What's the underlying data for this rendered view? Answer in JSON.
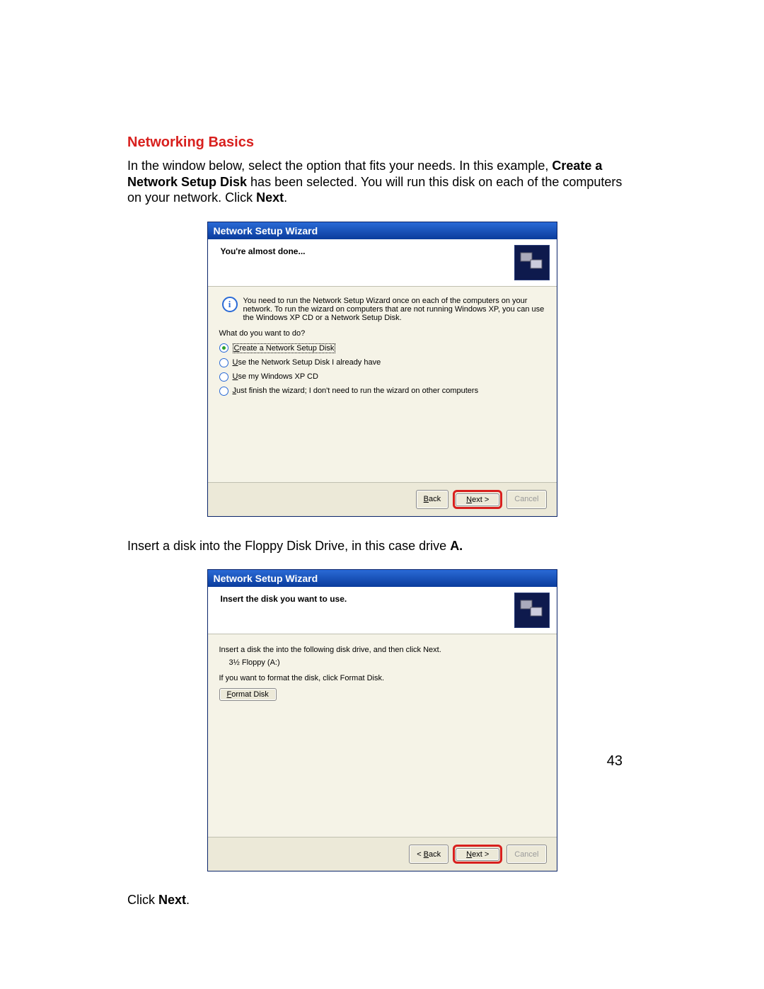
{
  "heading": "Networking Basics",
  "intro": {
    "p1a": "In the window below, select the option that fits your needs. In this example, ",
    "p1b_bold": "Create a Network Setup Disk",
    "p1c": " has been selected.  You will run this disk on each of the computers on your network. Click ",
    "p1d_bold": "Next",
    "p1e": "."
  },
  "wizard1": {
    "titlebar": "Network Setup Wizard",
    "header_title": "You're almost done...",
    "icon_alt": "computers",
    "info_text": "You need to run the Network Setup Wizard once on each of the computers on your network. To run the wizard on computers that are not running Windows XP, you can use the Windows XP CD or a Network Setup Disk.",
    "question": "What do you want to do?",
    "options": [
      {
        "prefix": "C",
        "label_rest": "reate a Network Setup Disk",
        "selected": true,
        "boxed": true
      },
      {
        "prefix": "U",
        "label_rest": "se the Network Setup Disk I already have",
        "selected": false,
        "boxed": false
      },
      {
        "prefix": "U",
        "label_rest": "se my Windows XP CD",
        "selected": false,
        "boxed": false
      },
      {
        "prefix": "J",
        "label_rest": "ust finish the wizard; I don't need to run the wizard on other computers",
        "selected": false,
        "boxed": false
      }
    ],
    "buttons": {
      "back": "< Back",
      "next": "Next >",
      "cancel": "Cancel"
    }
  },
  "mid_text": {
    "a": "Insert a disk into the Floppy Disk Drive, in this case drive ",
    "b_bold": "A."
  },
  "wizard2": {
    "titlebar": "Network Setup Wizard",
    "header_title": "Insert the disk you want to use.",
    "icon_alt": "computers",
    "line1": "Insert a disk the into the following disk drive, and then click Next.",
    "drive": "3½ Floppy (A:)",
    "line2": "If you want to format the disk, click Format Disk.",
    "format_btn": "Format Disk",
    "buttons": {
      "back": "< Back",
      "next": "Next >",
      "cancel": "Cancel"
    }
  },
  "click_next": {
    "a": "Click ",
    "b_bold": "Next",
    "c": "."
  },
  "page_number": "43"
}
